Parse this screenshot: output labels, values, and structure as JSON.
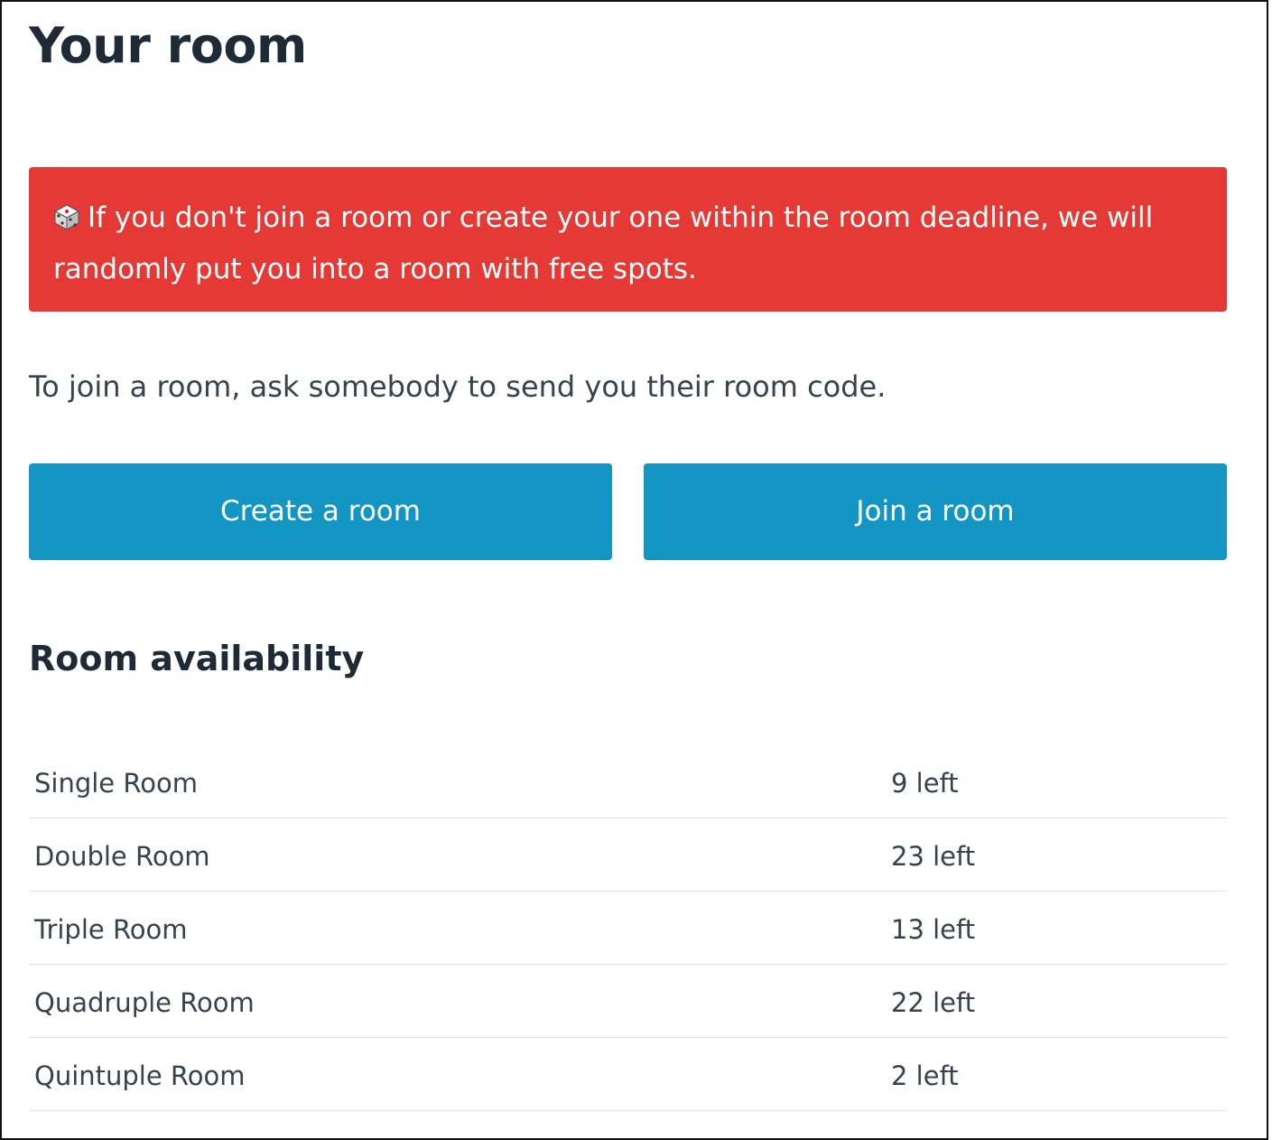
{
  "page": {
    "title": "Your room"
  },
  "alert": {
    "icon": "dice-icon",
    "text": "If you don't join a room or create your one within the room deadline, we will randomly put you into a room with free spots.",
    "background": "#e53935"
  },
  "intro": {
    "text": "To join a room, ask somebody to send you their room code."
  },
  "actions": {
    "create_label": "Create a room",
    "join_label": "Join a room",
    "button_color": "#1396c3"
  },
  "availability": {
    "title": "Room availability",
    "rows": [
      {
        "name": "Single Room",
        "count": "9 left"
      },
      {
        "name": "Double Room",
        "count": "23 left"
      },
      {
        "name": "Triple Room",
        "count": "13 left"
      },
      {
        "name": "Quadruple Room",
        "count": "22 left"
      },
      {
        "name": "Quintuple Room",
        "count": "2 left"
      }
    ]
  }
}
